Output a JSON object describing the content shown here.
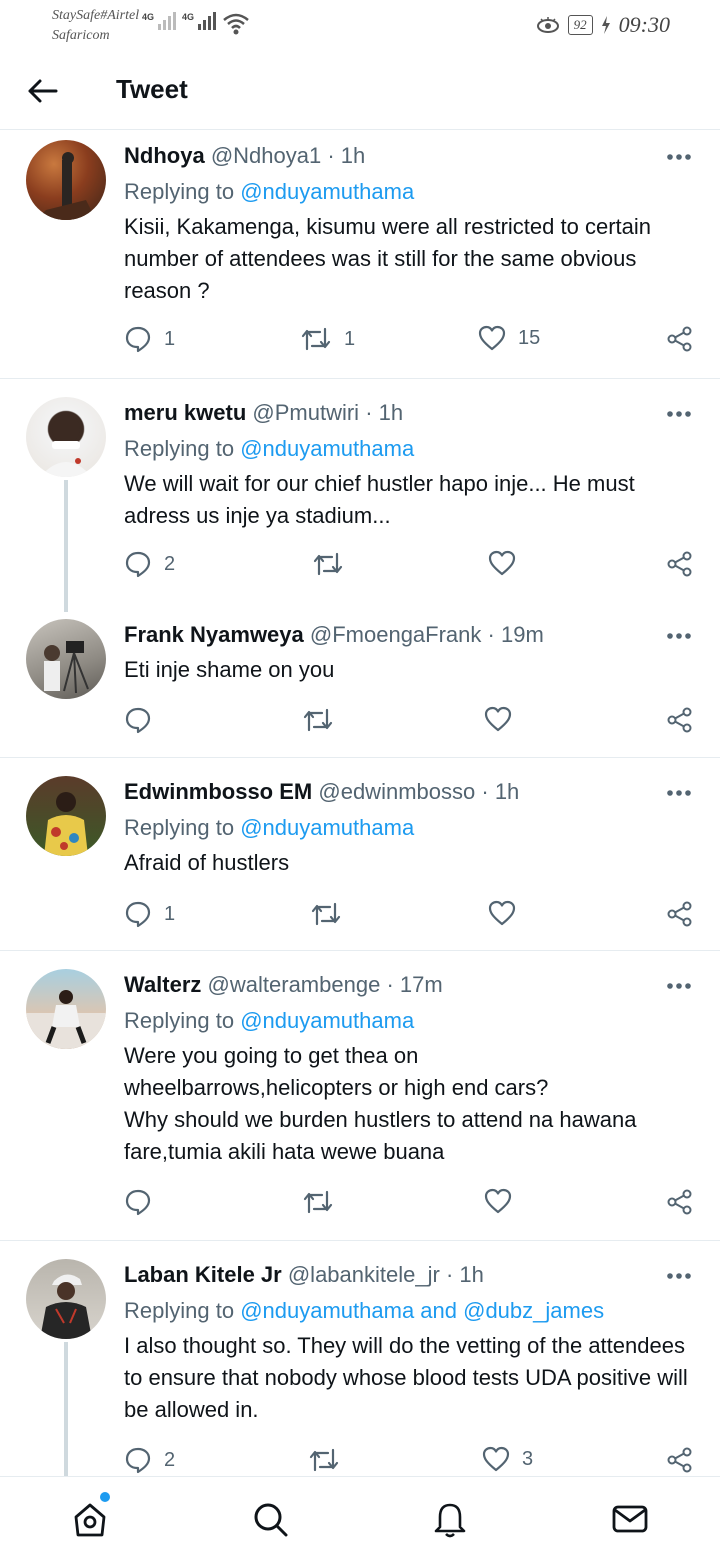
{
  "status": {
    "carrier1": "StaySafe#Airtel",
    "carrier2": "Safaricom",
    "net1": "4G",
    "net2": "4G",
    "battery": "92",
    "time": "09:30"
  },
  "header": {
    "title": "Tweet",
    "back_icon": "arrow-left-icon"
  },
  "tweets": [
    {
      "name": "Ndhoya",
      "handle": "@Ndhoya1",
      "time": "1h",
      "replying_label": "Replying to",
      "replying_to": "@nduyamuthama",
      "text": "Kisii, Kakamenga, kisumu were all restricted to certain number of attendees was it still for the same obvious reason  ?",
      "replies": "1",
      "retweets": "1",
      "likes": "15"
    },
    {
      "name": "meru kwetu",
      "handle": "@Pmutwiri",
      "time": "1h",
      "replying_label": "Replying to",
      "replying_to": "@nduyamuthama",
      "text": "We will wait for our chief hustler hapo inje... He must adress us inje ya stadium...",
      "replies": "2",
      "retweets": "",
      "likes": ""
    },
    {
      "name": "Frank Nyamweya",
      "handle": "@FmoengaFrank",
      "time": "19m",
      "replying_label": "",
      "replying_to": "",
      "text": "Eti inje shame on you",
      "replies": "",
      "retweets": "",
      "likes": ""
    },
    {
      "name": "Edwinmbosso EM",
      "handle": "@edwinmbosso",
      "time": "1h",
      "replying_label": "Replying to",
      "replying_to": "@nduyamuthama",
      "text": "Afraid of hustlers",
      "replies": "1",
      "retweets": "",
      "likes": ""
    },
    {
      "name": "Walterz",
      "handle": "@walterambenge",
      "time": "17m",
      "replying_label": "Replying to",
      "replying_to": "@nduyamuthama",
      "text": "Were you going to get thea on\nwheelbarrows,helicopters or high end cars?\nWhy should we burden hustlers to attend na hawana fare,tumia akili hata wewe buana",
      "replies": "",
      "retweets": "",
      "likes": ""
    },
    {
      "name": "Laban Kitele Jr",
      "handle": "@labankitele_jr",
      "time": "1h",
      "replying_label": "Replying to",
      "replying_to": "@nduyamuthama and @dubz_james",
      "text": "I also thought so. They will do the vetting of the attendees to ensure that nobody whose blood tests UDA positive will be allowed in.",
      "replies": "2",
      "retweets": "",
      "likes": "3"
    }
  ],
  "nav": [
    "home-icon",
    "search-icon",
    "notifications-bell-icon",
    "messages-mail-icon"
  ]
}
